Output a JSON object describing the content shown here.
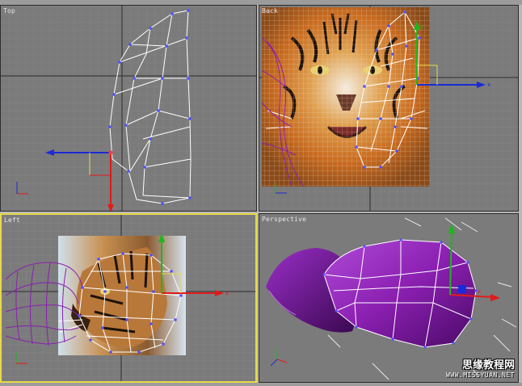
{
  "viewports": {
    "top": {
      "label": "Top"
    },
    "back": {
      "label": "Back"
    },
    "left": {
      "label": "Left"
    },
    "perspective": {
      "label": "Perspective"
    }
  },
  "active_viewport": "Left",
  "axis_labels": {
    "x": "x",
    "y": "y",
    "z": "z"
  },
  "watermark": {
    "site_name": "思缘教程网",
    "url": "WWW.MISSYUAN.NET"
  },
  "colors": {
    "viewport_bg": "#7b7b7b",
    "active_border": "#e8d84a",
    "mesh_purple": "#8a1fb0",
    "vertex_blue": "#4a4aff",
    "x_axis": "#e11b1b",
    "y_axis": "#1bb81b",
    "z_axis": "#1b2bd6"
  },
  "icons": [
    "axis-gizmo-icon",
    "world-axis-icon"
  ]
}
